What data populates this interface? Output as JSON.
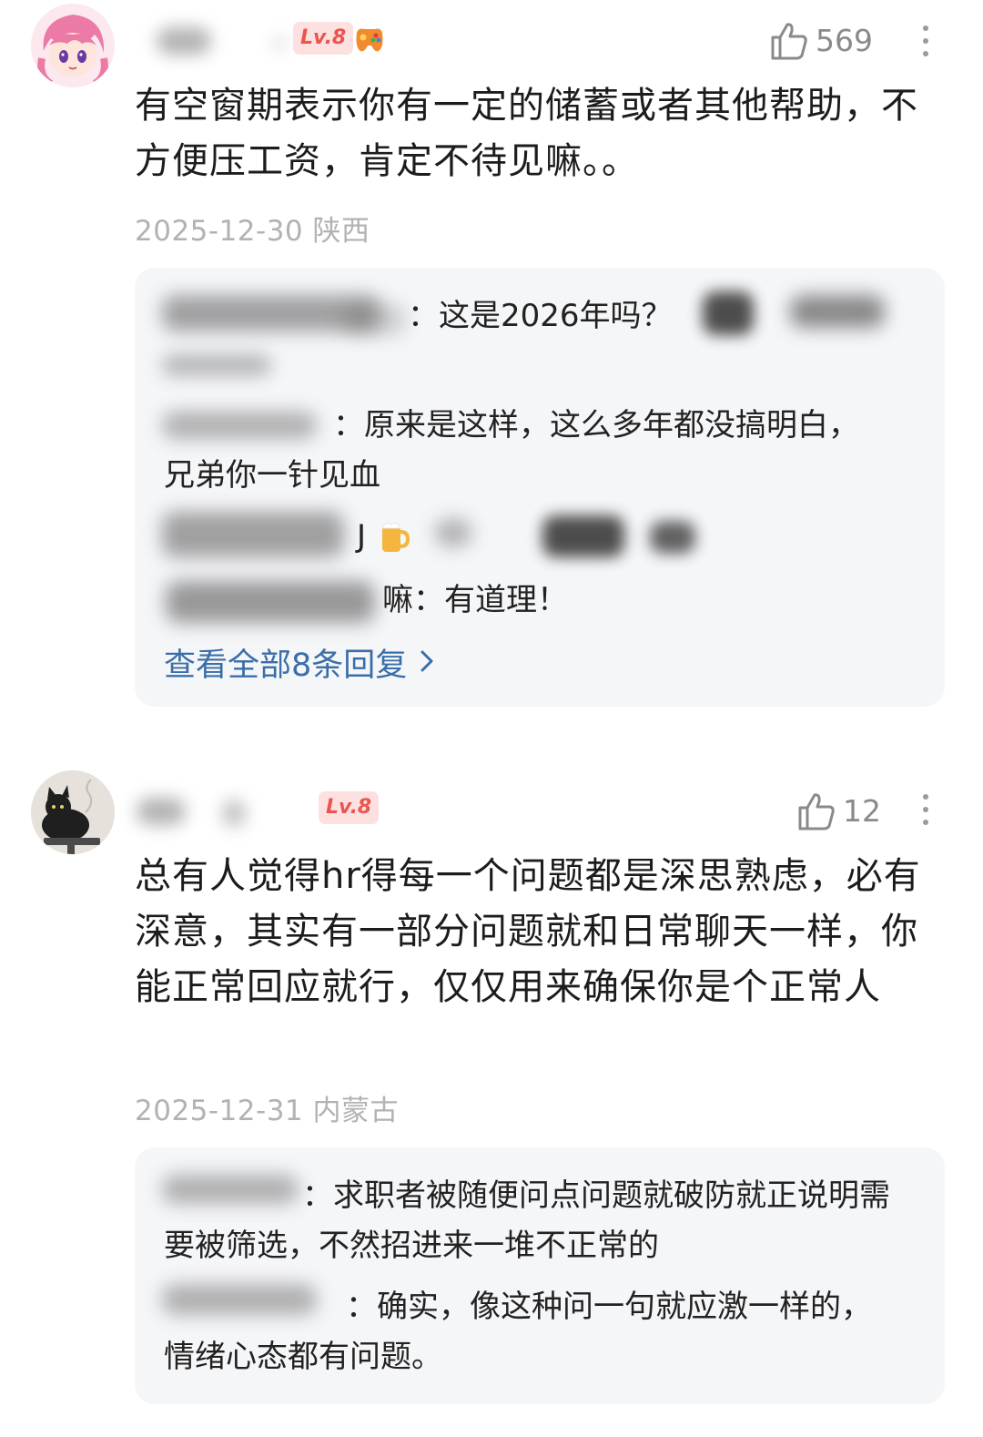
{
  "comments": [
    {
      "level_badge": "Lv.8",
      "likes": "569",
      "text": "有空窗期表示你有一定的储蓄或者其他帮助，不方便压工资，肯定不待见嘛。。",
      "meta": "2025-12-30 陕西",
      "replies": [
        {
          "tail": "：这是2026年吗？"
        },
        {
          "tail": "：原来是这样，这么多年都没搞明白，兄弟你一针见血"
        },
        {
          "tail": "J"
        },
        {
          "tail": "嘛：有道理！"
        }
      ],
      "view_all": "查看全部8条回复",
      "icons": {
        "badge": "gamepad-icon",
        "like": "thumbs-up-icon",
        "more": "more-vertical-icon",
        "chevron": "chevron-right-icon",
        "emoji": "beer-icon"
      }
    },
    {
      "level_badge": "Lv.8",
      "likes": "12",
      "text": "总有人觉得hr得每一个问题都是深思熟虑，必有深意，其实有一部分问题就和日常聊天一样，你能正常回应就行，仅仅用来确保你是个正常人",
      "meta": "2025-12-31 内蒙古",
      "replies": [
        {
          "tail": "：求职者被随便问点问题就破防就正说明需要被筛选，不然招进来一堆不正常的"
        },
        {
          "tail": "：确实，像这种问一句就应激一样的，情绪心态都有问题。"
        }
      ]
    }
  ],
  "colors": {
    "link": "#3a6ea8",
    "badge_text": "#e8564f",
    "badge_bg": "#fde1e1",
    "meta": "#b2b2b2",
    "reply_bg": "#f5f6f8"
  }
}
